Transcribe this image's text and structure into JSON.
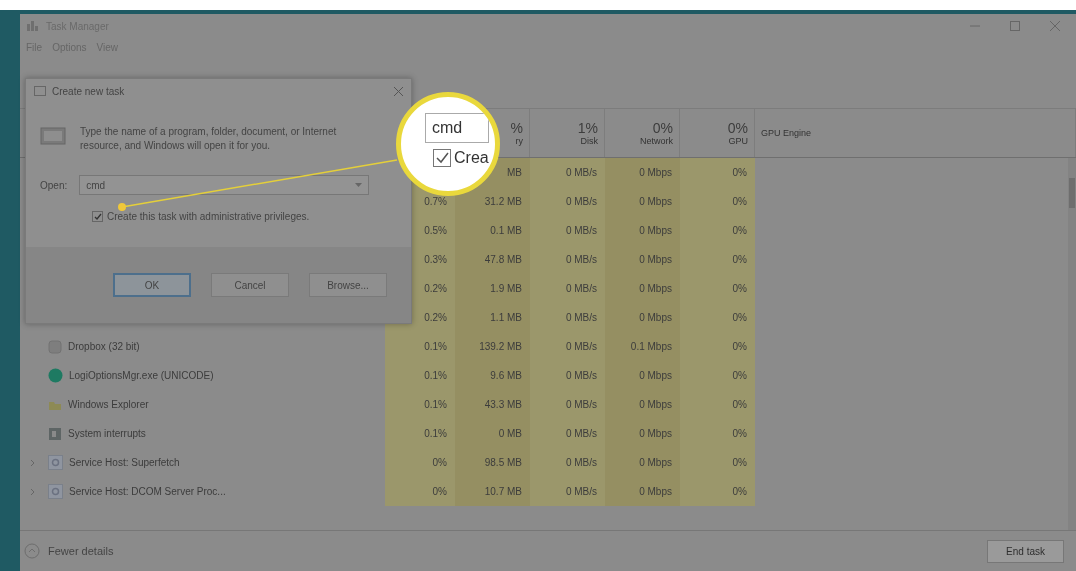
{
  "window": {
    "title": "Task Manager",
    "menu": [
      "File",
      "Options",
      "View"
    ]
  },
  "columns": [
    {
      "value": "%",
      "label": "ry"
    },
    {
      "value": "1%",
      "label": "Disk"
    },
    {
      "value": "0%",
      "label": "Network"
    },
    {
      "value": "0%",
      "label": "GPU"
    },
    {
      "label": "GPU Engine"
    }
  ],
  "rows": [
    {
      "memory": "MB",
      "disk": "0 MB/s",
      "network": "0 Mbps",
      "gpu": "0%"
    },
    {
      "cpu": "0.7%",
      "memory": "31.2 MB",
      "disk": "0 MB/s",
      "network": "0 Mbps",
      "gpu": "0%"
    },
    {
      "cpu": "0.5%",
      "memory": "0.1 MB",
      "disk": "0 MB/s",
      "network": "0 Mbps",
      "gpu": "0%"
    },
    {
      "cpu": "0.3%",
      "memory": "47.8 MB",
      "disk": "0 MB/s",
      "network": "0 Mbps",
      "gpu": "0%"
    },
    {
      "cpu": "0.2%",
      "memory": "1.9 MB",
      "disk": "0 MB/s",
      "network": "0 Mbps",
      "gpu": "0%"
    },
    {
      "cpu": "0.2%",
      "memory": "1.1 MB",
      "disk": "0 MB/s",
      "network": "0 Mbps",
      "gpu": "0%"
    },
    {
      "name": "Dropbox (32 bit)",
      "kind": "box",
      "cpu": "0.1%",
      "memory": "139.2 MB",
      "disk": "0 MB/s",
      "network": "0.1 Mbps",
      "gpu": "0%"
    },
    {
      "name": "LogiOptionsMgr.exe (UNICODE)",
      "kind": "dot",
      "cpu": "0.1%",
      "memory": "9.6 MB",
      "disk": "0 MB/s",
      "network": "0 Mbps",
      "gpu": "0%"
    },
    {
      "name": "Windows Explorer",
      "kind": "folder",
      "cpu": "0.1%",
      "memory": "43.3 MB",
      "disk": "0 MB/s",
      "network": "0 Mbps",
      "gpu": "0%"
    },
    {
      "name": "System interrupts",
      "kind": "chip",
      "cpu": "0.1%",
      "memory": "0 MB",
      "disk": "0 MB/s",
      "network": "0 Mbps",
      "gpu": "0%"
    },
    {
      "name": "Service Host: Superfetch",
      "kind": "service",
      "cpu": "0%",
      "memory": "98.5 MB",
      "disk": "0 MB/s",
      "network": "0 Mbps",
      "gpu": "0%"
    },
    {
      "name": "Service Host: DCOM Server Proc...",
      "kind": "service",
      "cpu": "0%",
      "memory": "10.7 MB",
      "disk": "0 MB/s",
      "network": "0 Mbps",
      "gpu": "0%"
    }
  ],
  "footer": {
    "link": "Fewer details",
    "button": "End task"
  },
  "dialog": {
    "title": "Create new task",
    "message": "Type the name of a program, folder, document, or Internet resource, and Windows will open it for you.",
    "open_label": "Open:",
    "open_value": "cmd",
    "checkbox_label": "Create this task with administrative privileges.",
    "checked": true,
    "buttons": [
      {
        "label": "OK",
        "selected": true
      },
      {
        "label": "Cancel",
        "selected": false
      },
      {
        "label": "Browse...",
        "selected": false
      }
    ]
  },
  "callout": {
    "field_value": "cmd",
    "checkbox_label": "Crea",
    "checked": true
  }
}
